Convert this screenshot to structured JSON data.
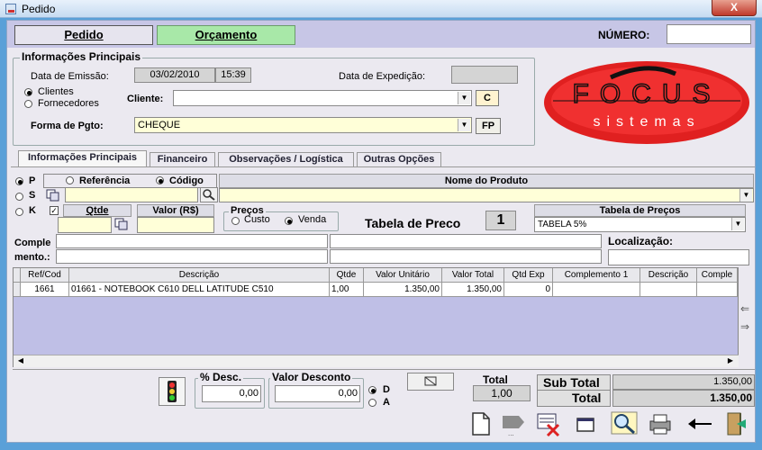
{
  "window": {
    "title": "Pedido",
    "close_label": "X"
  },
  "header": {
    "tab_pedido": "Pedido",
    "tab_orcamento": "Orçamento",
    "numero_label": "NÚMERO:",
    "numero_value": ""
  },
  "info": {
    "group_title": "Informações Principais",
    "data_emissao_label": "Data de Emissão:",
    "data_emissao": "03/02/2010",
    "hora": "15:39",
    "data_expedicao_label": "Data de Expedição:",
    "data_expedicao": "",
    "radio_clientes": "Clientes",
    "radio_fornecedores": "Fornecedores",
    "cliente_label": "Cliente:",
    "cliente_value": "",
    "c_button": "C",
    "forma_pgto_label": "Forma de Pgto:",
    "forma_pgto_value": "CHEQUE",
    "fp_button": "FP"
  },
  "logo": {
    "top_text": "FOCUS",
    "bottom_text": "sistemas"
  },
  "page_tabs": [
    "Informações Principais",
    "Financeiro",
    "Observações / Logística",
    "Outras Opções"
  ],
  "product": {
    "radio_p": "P",
    "radio_s": "S",
    "radio_k": "K",
    "referencia": "Referência",
    "codigo": "Código",
    "nome_produto": "Nome do Produto",
    "qtde": "Qtde",
    "valor": "Valor (R$)",
    "precos_title": "Preços",
    "custo": "Custo",
    "venda": "Venda",
    "tabela_preco_label": "Tabela de Preco",
    "tabela_preco_num": "1",
    "tabela_precos_title": "Tabela de Preços",
    "tabela_precos_value": "TABELA 5%",
    "complemento_label_1": "Comple",
    "complemento_label_2": "mento.:",
    "localizacao_label": "Localização:"
  },
  "grid": {
    "columns": [
      "Ref/Cod",
      "Descrição",
      "Qtde",
      "Valor Unitário",
      "Valor Total",
      "Qtd Exp",
      "Complemento 1",
      "Descrição",
      "Comple"
    ],
    "rows": [
      [
        "1661",
        "01661 - NOTEBOOK  C610     DELL  LATITUDE C510",
        "1,00",
        "1.350,00",
        "1.350,00",
        "0",
        "",
        "",
        ""
      ]
    ]
  },
  "footer": {
    "desc_label": "% Desc.",
    "desc_value": "0,00",
    "valor_desconto_label": "Valor Desconto",
    "valor_desconto_value": "0,00",
    "radio_d": "D",
    "radio_a": "A",
    "total_label": "Total",
    "total_value": "1,00",
    "subtotal_label": "Sub Total",
    "subtotal_value": "1.350,00",
    "total2_label": "Total",
    "total2_value": "1.350,00"
  },
  "colors": {
    "accent_green": "#a8e8a8",
    "header_band": "#c7c6e6",
    "grid_empty": "#bfbfe6",
    "logo_red": "#e02020"
  },
  "toolbar_icons": [
    "new-document-icon",
    "edit-icon",
    "delete-icon",
    "window-icon",
    "search-icon",
    "print-icon",
    "back-arrow-icon",
    "exit-icon"
  ]
}
